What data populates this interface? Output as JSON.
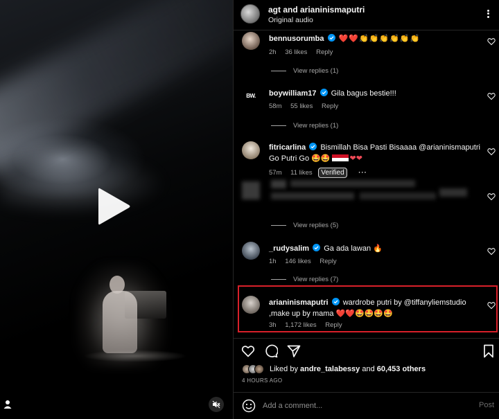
{
  "post": {
    "header": {
      "title": "agt and arianinismaputri",
      "subtitle": "Original audio"
    },
    "comments": [
      {
        "username": "bennusorumba",
        "text": "❤️❤️👏👏👏👏👏👏",
        "time": "2h",
        "likes": "36 likes",
        "reply": "Reply",
        "view_replies": "View replies (1)",
        "verified": true
      },
      {
        "username": "boywilliam17",
        "text": "Gila bagus bestie!!!",
        "time": "58m",
        "likes": "55 likes",
        "reply": "Reply",
        "view_replies": "View replies (1)",
        "verified": true
      },
      {
        "username": "fitricarlina",
        "text": "Bismillah Bisa Pasti Bisaaaa @arianinismaputri",
        "text2": "Go Putri Go 🤩🤩",
        "time": "57m",
        "likes": "11 likes",
        "tooltip": "Verified",
        "verified": true
      },
      {
        "view_replies": "View replies (5)"
      },
      {
        "username": "_rudysalim",
        "text": "Ga ada lawan 🔥",
        "time": "1h",
        "likes": "146 likes",
        "reply": "Reply",
        "view_replies": "View replies (7)",
        "verified": true
      },
      {
        "username": "arianinismaputri",
        "text": "wardrobe putri by @tiffanyliemstudio",
        "text2": ",make up by mama ❤️❤️🤩🤩🤩🤩",
        "time": "3h",
        "likes": "1,172 likes",
        "reply": "Reply",
        "verified": true
      }
    ],
    "liked_by": {
      "prefix": "Liked by",
      "user": "andre_talabessy",
      "middle": "and",
      "others": "60,453 others"
    },
    "time_ago": "4 HOURS AGO",
    "comment_box": {
      "placeholder": "Add a comment...",
      "post_label": "Post"
    }
  },
  "colors": {
    "highlight_border": "#d9202a",
    "verified_blue": "#0095f6",
    "heart_red": "#ed4956",
    "muted_text": "#a8a8a8"
  }
}
